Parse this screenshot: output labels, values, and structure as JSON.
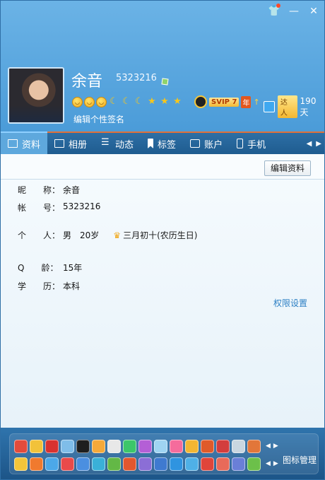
{
  "profile": {
    "name": "余音",
    "qq_number": "5323216",
    "signature": "编辑个性签名",
    "svip_label": "SVIP 7",
    "svip_year": "年",
    "expert_label": "达人",
    "expert_days": "190天"
  },
  "window_controls": {
    "shirt": "shirt-icon",
    "minimize": "minimize-icon",
    "close": "close-icon"
  },
  "tabs": [
    {
      "label": "资料",
      "icon": "id-card-icon"
    },
    {
      "label": "相册",
      "icon": "photo-icon"
    },
    {
      "label": "动态",
      "icon": "list-icon"
    },
    {
      "label": "标签",
      "icon": "bookmark-icon"
    },
    {
      "label": "账户",
      "icon": "briefcase-icon"
    },
    {
      "label": "手机",
      "icon": "phone-icon"
    }
  ],
  "active_tab": "资料",
  "content": {
    "edit_button": "编辑资料",
    "nickname_label": "昵　　称：",
    "nickname": "余音",
    "account_label": "帐　　号：",
    "account": "5323216",
    "personal_label": "个　　人：",
    "gender": "男",
    "age": "20岁",
    "birthday": "三月初十(农历生日)",
    "qage_label": "Q　　龄：",
    "qage": "15年",
    "education_label": "学　　历：",
    "education": "本科",
    "permission_link": "权限设置"
  },
  "bottom": {
    "manage_label": "图标管理"
  },
  "colors": {
    "accent": "#2c7fc4",
    "header_top": "#6bb3e6",
    "tab_bar": "#1f5c90",
    "tab_active": "#5ea8dd",
    "tab_accent_line": "#e0713a"
  }
}
